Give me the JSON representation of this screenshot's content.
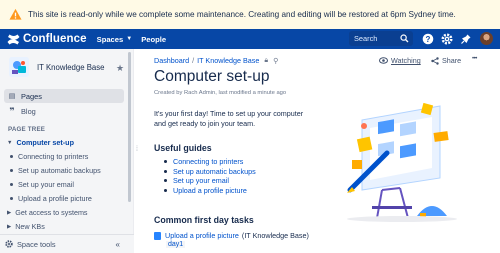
{
  "banner": {
    "text": "This site is read-only while we complete some maintenance. Creating and editing will be restored at 6pm Sydney time.",
    "bg_color": "#fffae6",
    "icon": "warning-icon"
  },
  "topnav": {
    "brand": "Confluence",
    "spaces_label": "Spaces",
    "people_label": "People",
    "search_placeholder": "Search",
    "bg_color": "#0747a6",
    "icons": [
      "help-icon",
      "settings-icon",
      "notifications-icon",
      "avatar"
    ]
  },
  "sidebar": {
    "space_name": "IT Knowledge Base",
    "nav": [
      {
        "label": "Pages",
        "icon": "pages-icon",
        "active": true
      },
      {
        "label": "Blog",
        "icon": "quote-icon",
        "active": false
      }
    ],
    "page_tree_label": "PAGE TREE",
    "tree": {
      "current": "Computer set-up",
      "children": [
        "Connecting to printers",
        "Set up automatic backups",
        "Set up your email",
        "Upload a profile picture"
      ],
      "siblings": [
        "Get access to systems",
        "New KBs"
      ]
    },
    "space_tools_label": "Space tools"
  },
  "main": {
    "breadcrumb": [
      "Dashboard",
      "IT Knowledge Base"
    ],
    "watching_label": "Watching",
    "share_label": "Share",
    "more_label": "•••",
    "title": "Computer set-up",
    "byline": "Created by Rach Admin, last modified a minute ago",
    "intro": "It's your first day!  Time to set up your computer and get ready to join your team.",
    "guides_heading": "Useful guides",
    "guides": [
      "Connecting to printers",
      "Set up automatic backups",
      "Set up your email",
      "Upload a profile picture"
    ],
    "tasks_heading": "Common first day tasks",
    "task": {
      "link": "Upload a profile picture",
      "space": "(IT Knowledge Base)",
      "label": "day1"
    }
  }
}
